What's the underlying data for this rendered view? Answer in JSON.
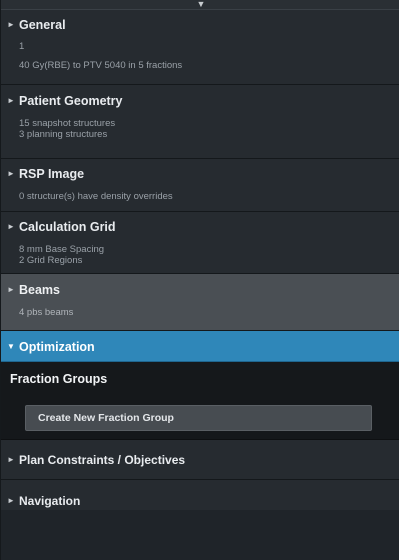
{
  "collapse_glyph": "▼",
  "sections": {
    "general": {
      "title": "General",
      "lines": [
        "1",
        "40 Gy(RBE) to PTV 5040 in 5 fractions"
      ]
    },
    "patient_geometry": {
      "title": "Patient Geometry",
      "lines": [
        "15 snapshot structures",
        "3 planning structures"
      ]
    },
    "rsp_image": {
      "title": "RSP Image",
      "lines": [
        "0 structure(s) have density overrides"
      ]
    },
    "calculation_grid": {
      "title": "Calculation Grid",
      "lines": [
        "8 mm Base Spacing",
        "2 Grid Regions"
      ]
    },
    "beams": {
      "title": "Beams",
      "lines": [
        "4 pbs beams"
      ]
    },
    "optimization": {
      "title": "Optimization"
    },
    "fraction_groups": {
      "title": "Fraction Groups",
      "create_label": "Create New Fraction Group"
    },
    "plan_constraints": {
      "title": "Plan Constraints / Objectives"
    },
    "navigation": {
      "title": "Navigation"
    }
  },
  "glyphs": {
    "collapsed": "►",
    "expanded": "▼"
  },
  "colors": {
    "panel_bg": "#262b30",
    "selected_section": "#4a4f54",
    "active_header": "#2f87b9",
    "fraction_bg": "#15181b"
  }
}
